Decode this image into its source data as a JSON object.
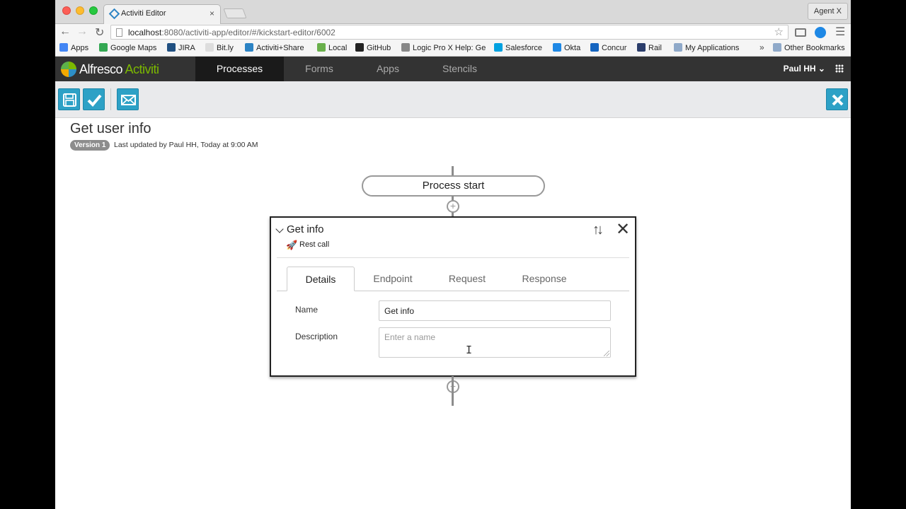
{
  "browser": {
    "tab_title": "Activiti Editor",
    "tab_close": "×",
    "profile": "Agent X",
    "url_host": "localhost",
    "url_rest": ":8080/activiti-app/editor/#/kickstart-editor/6002",
    "bookmarks": [
      {
        "label": "Apps",
        "icon": "apps-grid-icon",
        "color": "#4285f4"
      },
      {
        "label": "Google Maps",
        "icon": "maps-icon",
        "color": "#34a853"
      },
      {
        "label": "JIRA",
        "icon": "jira-icon",
        "color": "#205081"
      },
      {
        "label": "Bit.ly",
        "icon": "page-icon",
        "color": "#dddddd"
      },
      {
        "label": "Activiti+Share",
        "icon": "activiti-icon",
        "color": "#2c83c4"
      },
      {
        "label": "Local",
        "icon": "leaf-icon",
        "color": "#6ab04c"
      },
      {
        "label": "GitHub",
        "icon": "github-icon",
        "color": "#222222"
      },
      {
        "label": "Logic Pro X Help: Ge",
        "icon": "apple-icon",
        "color": "#888888"
      },
      {
        "label": "Salesforce",
        "icon": "cloud-icon",
        "color": "#00a1e0"
      },
      {
        "label": "Okta",
        "icon": "okta-icon",
        "color": "#1e88e5"
      },
      {
        "label": "Concur",
        "icon": "concur-icon",
        "color": "#1565c0"
      },
      {
        "label": "Rail",
        "icon": "rail-icon",
        "color": "#2b3d6b"
      },
      {
        "label": "My Applications",
        "icon": "folder-icon",
        "color": "#8fa9c9"
      }
    ],
    "bookmarks_more": "»",
    "other_bookmarks": "Other Bookmarks"
  },
  "app": {
    "logo_brand": "Alfresco",
    "logo_product": "Activiti",
    "nav": [
      "Processes",
      "Forms",
      "Apps",
      "Stencils"
    ],
    "active_nav": "Processes",
    "user": "Paul HH ⌄"
  },
  "actions": {
    "save_icon": "save-icon",
    "validate_icon": "checkmark-icon",
    "email_icon": "envelope-icon",
    "close_icon": "close-icon",
    "accent_color": "#2da1c6"
  },
  "process": {
    "title": "Get user info",
    "version": "Version 1",
    "last_updated": "Last updated by Paul HH, Today at 9:00 AM",
    "start_label": "Process start"
  },
  "step": {
    "title": "Get info",
    "type": "Rest call",
    "tabs": [
      "Details",
      "Endpoint",
      "Request",
      "Response"
    ],
    "active_tab": "Details",
    "fields": {
      "name_label": "Name",
      "name_value": "Get info",
      "description_label": "Description",
      "description_placeholder": "Enter a name"
    }
  }
}
